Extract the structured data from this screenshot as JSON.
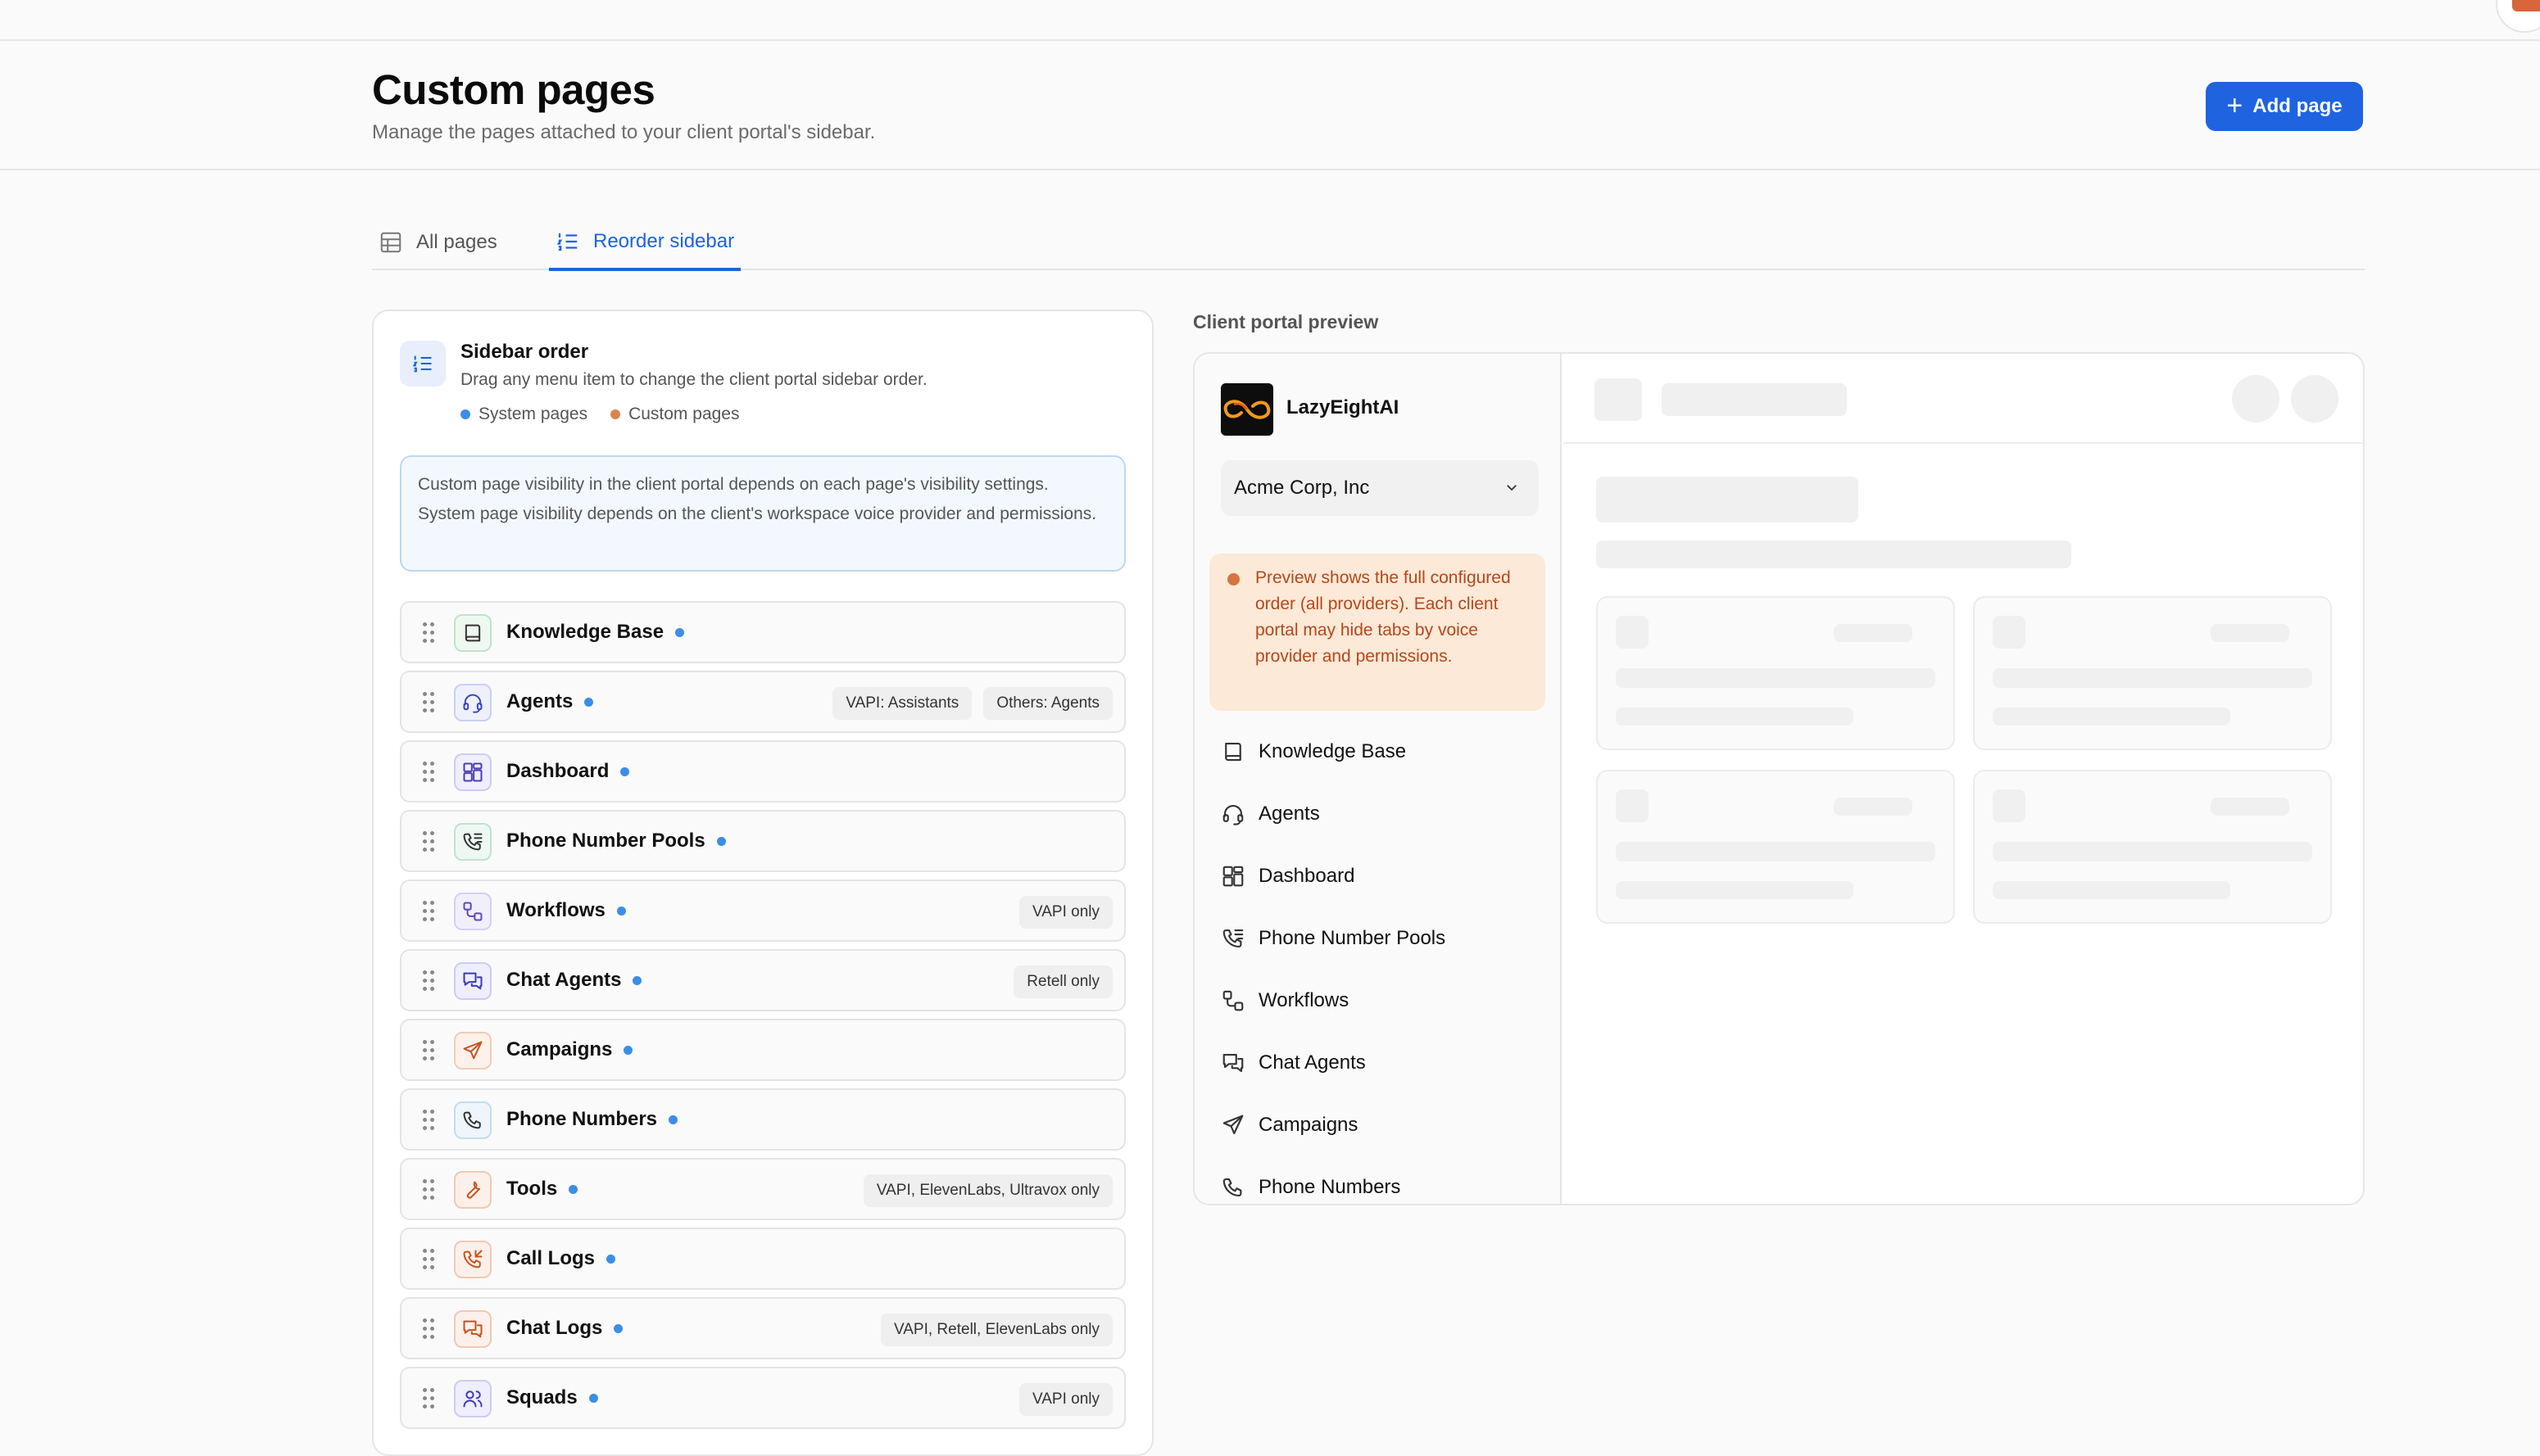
{
  "page": {
    "title": "Custom pages",
    "subtitle": "Manage the pages attached to your client portal's sidebar.",
    "add_button": "Add page"
  },
  "tabs": [
    {
      "label": "All pages",
      "icon": "table-icon",
      "active": false
    },
    {
      "label": "Reorder sidebar",
      "icon": "list-order-icon",
      "active": true
    }
  ],
  "sidebar_order": {
    "title": "Sidebar order",
    "description": "Drag any menu item to change the client portal sidebar order.",
    "legend": [
      {
        "label": "System pages",
        "color": "#3b8ee6"
      },
      {
        "label": "Custom pages",
        "color": "#d9864e"
      }
    ],
    "info": "Custom page visibility in the client portal depends on each page's visibility settings. System page visibility depends on the client's workspace voice provider and permissions.",
    "items": [
      {
        "label": "Knowledge Base",
        "icon": "book-icon",
        "badges": []
      },
      {
        "label": "Agents",
        "icon": "headset-icon",
        "badges": [
          "VAPI: Assistants",
          "Others: Agents"
        ]
      },
      {
        "label": "Dashboard",
        "icon": "dashboard-icon",
        "badges": []
      },
      {
        "label": "Phone Number Pools",
        "icon": "phone-list-icon",
        "badges": []
      },
      {
        "label": "Workflows",
        "icon": "workflow-icon",
        "badges": [
          "VAPI only"
        ]
      },
      {
        "label": "Chat Agents",
        "icon": "chat-icon",
        "badges": [
          "Retell only"
        ]
      },
      {
        "label": "Campaigns",
        "icon": "send-icon",
        "badges": []
      },
      {
        "label": "Phone Numbers",
        "icon": "phone-icon",
        "badges": []
      },
      {
        "label": "Tools",
        "icon": "wrench-icon",
        "badges": [
          "VAPI, ElevenLabs, Ultravox only"
        ]
      },
      {
        "label": "Call Logs",
        "icon": "phone-incoming-icon",
        "badges": []
      },
      {
        "label": "Chat Logs",
        "icon": "chat-logs-icon",
        "badges": [
          "VAPI, Retell, ElevenLabs only"
        ]
      },
      {
        "label": "Squads",
        "icon": "users-icon",
        "badges": [
          "VAPI only"
        ]
      }
    ]
  },
  "preview": {
    "label": "Client portal preview",
    "brand": "LazyEightAI",
    "workspace": "Acme Corp, Inc",
    "warning": "Preview shows the full configured order (all providers). Each client portal may hide tabs by voice provider and permissions.",
    "items": [
      "Knowledge Base",
      "Agents",
      "Dashboard",
      "Phone Number Pools",
      "Workflows",
      "Chat Agents",
      "Campaigns",
      "Phone Numbers"
    ]
  },
  "colors": {
    "accent": "#1f63e0",
    "system_dot": "#3b8ee6",
    "custom_dot": "#d9864e",
    "warning_text": "#b5471b"
  }
}
